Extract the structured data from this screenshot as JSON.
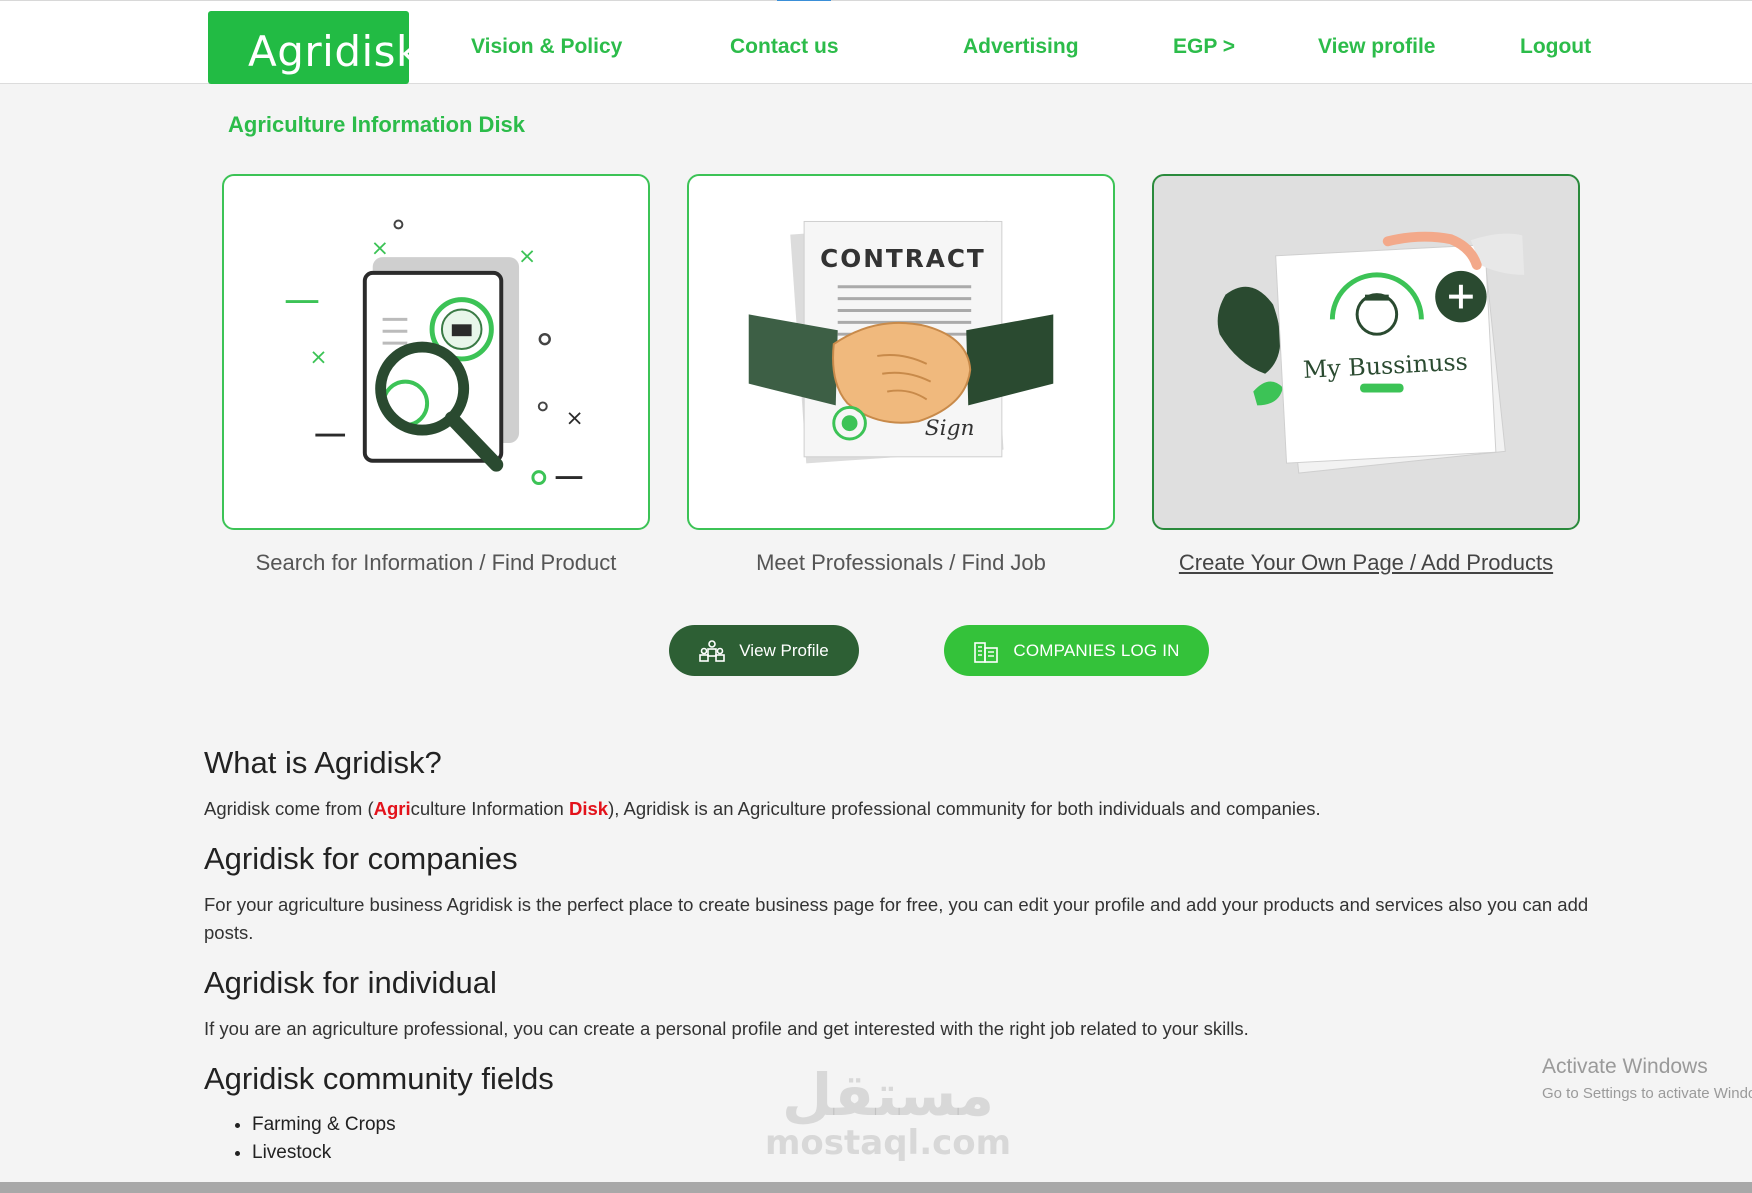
{
  "header": {
    "logo_text": "Agridisk",
    "nav": [
      "Vision & Policy",
      "Contact us",
      "Advertising",
      "EGP >",
      "View profile",
      "Logout"
    ]
  },
  "subtitle": "Agriculture Information Disk",
  "cards": [
    {
      "caption": "Search for Information / Find Product",
      "icon": "search-document-illustration"
    },
    {
      "caption": "Meet Professionals / Find Job",
      "icon": "contract-handshake-illustration",
      "image_text": "CONTRACT",
      "signature": "Sign"
    },
    {
      "caption": "Create Your Own Page / Add Products",
      "icon": "business-page-illustration",
      "image_text": "My Bussinuss"
    }
  ],
  "buttons": {
    "view_profile": "View Profile",
    "companies_login": "COMPANIES LOG IN"
  },
  "about": {
    "what_title": "What is Agridisk?",
    "what_text_prefix": "Agridisk come from (",
    "what_agri_red": "Agri",
    "what_culture": "culture Information ",
    "what_disk_red": "Disk",
    "what_text_suffix": "), Agridisk is an Agriculture professional community for both individuals and companies.",
    "companies_title": "Agridisk for companies",
    "companies_text": "For your agriculture business Agridisk is the perfect place to create business page for free, you can edit your profile and add your products and services also you can add posts.",
    "individual_title": "Agridisk for individual",
    "individual_text": "If you are an agriculture professional, you can create a personal profile and get interested with the right job related to your skills.",
    "fields_title": "Agridisk community fields",
    "fields": [
      "Farming & Crops",
      "Livestock"
    ]
  },
  "os_watermark": {
    "line1": "Activate Windows",
    "line2": "Go to Settings to activate Windows."
  },
  "site_watermark": {
    "arabic": "مستقل",
    "latin": "mostaql.com"
  },
  "colors": {
    "brand_green": "#22bb44",
    "dark_green": "#2d5f34",
    "accent_red": "#e3121b"
  }
}
